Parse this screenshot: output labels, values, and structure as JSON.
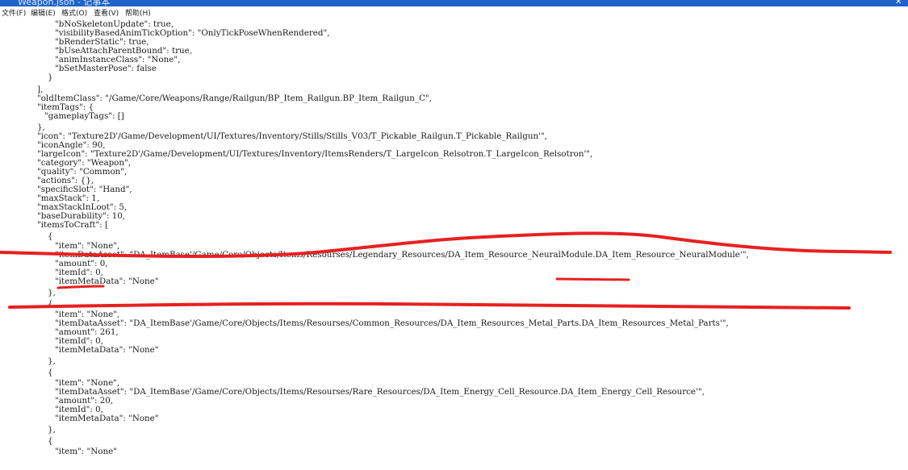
{
  "window": {
    "title": "Weapon.json - 记事本"
  },
  "menu": [
    "文件(F)",
    "编辑(E)",
    "格式(O)",
    "查看(V)",
    "帮助(H)"
  ],
  "colors": {
    "titlebar": "#1d63c9",
    "annotation": "#e82020",
    "text": "#1a1a1a"
  },
  "editor": {
    "lines": [
      "\"bNoSkeletonUpdate\": true,",
      "\"visibilityBasedAnimTickOption\": \"OnlyTickPoseWhenRendered\",",
      "\"bRenderStatic\": true,",
      "\"bUseAttachParentBound\": true,",
      "\"animInstanceClass\": \"None\",",
      "\"bSetMasterPose\": false",
      "}",
      "],",
      "\"oldItemClass\": \"/Game/Core/Weapons/Range/Railgun/BP_Item_Railgun.BP_Item_Railgun_C\",",
      "\"itemTags\": {",
      "\"gameplayTags\": []",
      "},",
      "\"icon\": \"Texture2D'/Game/Development/UI/Textures/Inventory/Stills/Stills_V03/T_Pickable_Railgun.T_Pickable_Railgun'\",",
      "\"iconAngle\": 90,",
      "\"largeIcon\": \"Texture2D'/Game/Development/UI/Textures/Inventory/ItemsRenders/T_LargeIcon_Relsotron.T_LargeIcon_Relsotron'\",",
      "\"category\": \"Weapon\",",
      "\"quality\": \"Common\",",
      "\"actions\": {},",
      "\"specificSlot\": \"Hand\",",
      "\"maxStack\": 1,",
      "\"maxStackInLoot\": 5,",
      "\"baseDurability\": 10,",
      "\"itemsToCraft\": [",
      "{",
      "\"item\": \"None\",",
      "\"itemDataAsset\": \"DA_ItemBase'/Game/Core/Objects/Items/Resourses/Legendary_Resources/DA_Item_Resource_NeuralModule.DA_Item_Resource_NeuralModule'\",",
      "\"amount\": 0,",
      "\"itemId\": 0,",
      "\"itemMetaData\": \"None\"",
      "},",
      "{",
      "\"item\": \"None\",",
      "\"itemDataAsset\": \"DA_ItemBase'/Game/Core/Objects/Items/Resourses/Common_Resources/DA_Item_Resources_Metal_Parts.DA_Item_Resources_Metal_Parts'\",",
      "\"amount\": 261,",
      "\"itemId\": 0,",
      "\"itemMetaData\": \"None\"",
      "},",
      "{",
      "\"item\": \"None\",",
      "\"itemDataAsset\": \"DA_ItemBase'/Game/Core/Objects/Items/Resourses/Rare_Resources/DA_Item_Energy_Cell_Resource.DA_Item_Energy_Cell_Resource'\",",
      "\"amount\": 20,",
      "\"itemId\": 0,",
      "\"itemMetaData\": \"None\"",
      "},",
      "{",
      "\"item\": \"None\""
    ]
  }
}
